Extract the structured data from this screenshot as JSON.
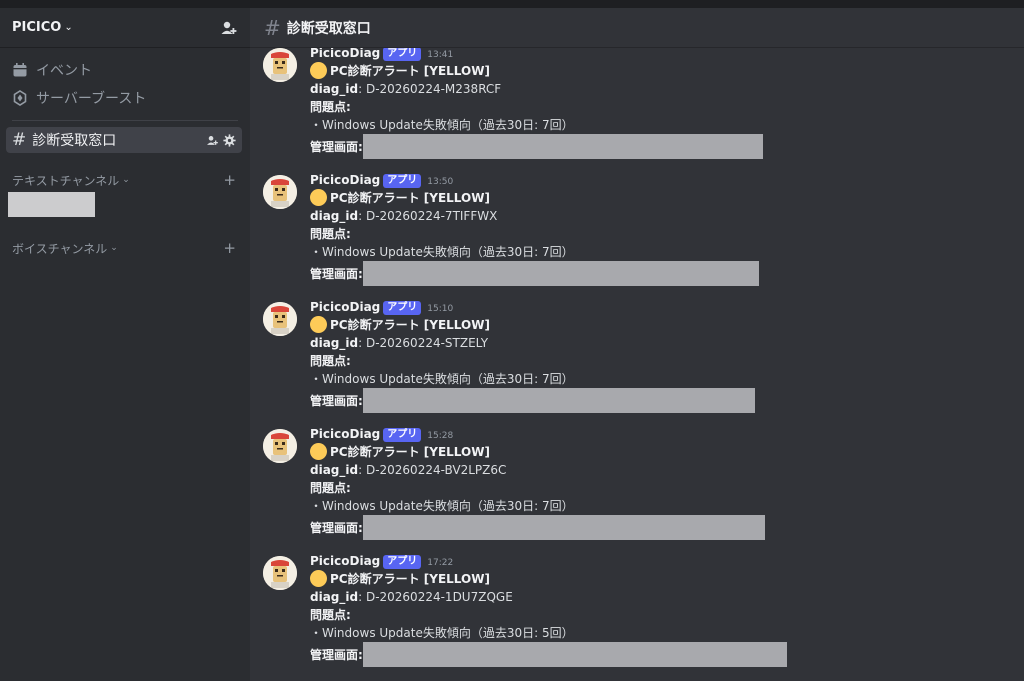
{
  "server": {
    "name": "PICICO"
  },
  "sidebar": {
    "items": [
      {
        "label": "イベント",
        "icon": "calendar-icon"
      },
      {
        "label": "サーバーブースト",
        "icon": "boost-icon"
      }
    ],
    "active_channel": "診断受取窓口",
    "categories": [
      {
        "label": "テキストチャンネル"
      },
      {
        "label": "ボイスチャンネル"
      }
    ]
  },
  "topbar": {
    "channel_name": "診断受取窓口"
  },
  "colors": {
    "app_tag": "#5865f2",
    "alert_dot": "#fdcb58"
  },
  "messages": [
    {
      "author": "PicicoDiag",
      "tag": "アプリ",
      "time": "13:41",
      "title": "PC診断アラート [YELLOW]",
      "diag_label": "diag_id",
      "diag_value": ": D-20260224-M238RCF",
      "issues_label": "問題点:",
      "issue": "・Windows Update失敗傾向（過去30日: 7回）",
      "admin_label": "管理画面:"
    },
    {
      "author": "PicicoDiag",
      "tag": "アプリ",
      "time": "13:50",
      "title": "PC診断アラート [YELLOW]",
      "diag_label": "diag_id",
      "diag_value": ": D-20260224-7TIFFWX",
      "issues_label": "問題点:",
      "issue": "・Windows Update失敗傾向（過去30日: 7回）",
      "admin_label": "管理画面:"
    },
    {
      "author": "PicicoDiag",
      "tag": "アプリ",
      "time": "15:10",
      "title": "PC診断アラート [YELLOW]",
      "diag_label": "diag_id",
      "diag_value": ": D-20260224-STZELY",
      "issues_label": "問題点:",
      "issue": "・Windows Update失敗傾向（過去30日: 7回）",
      "admin_label": "管理画面:"
    },
    {
      "author": "PicicoDiag",
      "tag": "アプリ",
      "time": "15:28",
      "title": "PC診断アラート [YELLOW]",
      "diag_label": "diag_id",
      "diag_value": ": D-20260224-BV2LPZ6C",
      "issues_label": "問題点:",
      "issue": "・Windows Update失敗傾向（過去30日: 7回）",
      "admin_label": "管理画面:"
    },
    {
      "author": "PicicoDiag",
      "tag": "アプリ",
      "time": "17:22",
      "title": "PC診断アラート [YELLOW]",
      "diag_label": "diag_id",
      "diag_value": ": D-20260224-1DU7ZQGE",
      "issues_label": "問題点:",
      "issue": "・Windows Update失敗傾向（過去30日: 5回）",
      "admin_label": "管理画面:"
    }
  ]
}
